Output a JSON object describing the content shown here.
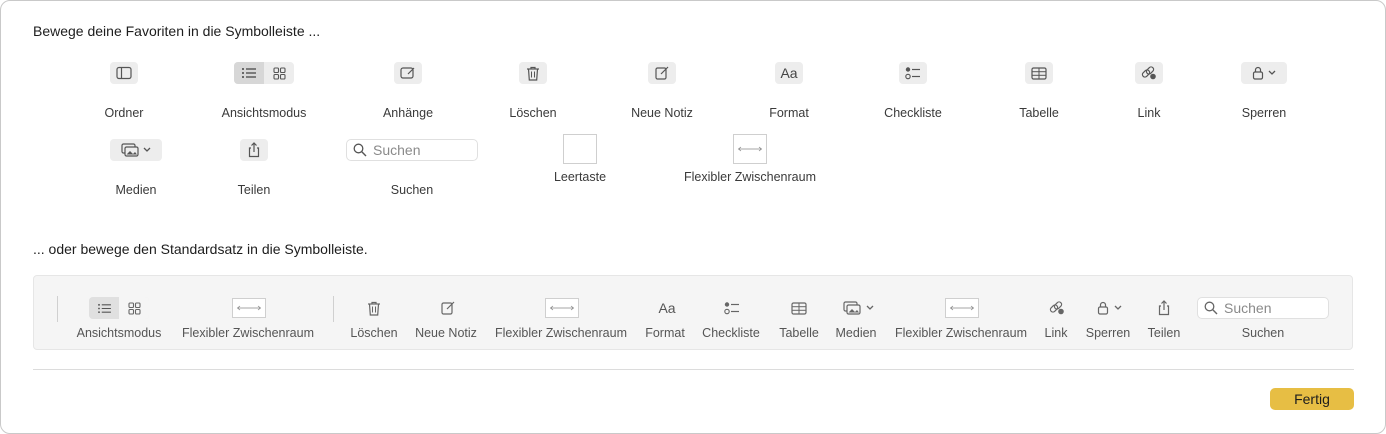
{
  "heading_favorites": "Bewege deine Favoriten in die Symbolleiste ...",
  "heading_default": "... oder bewege den Standardsatz in die Symbolleiste.",
  "palette": {
    "ordner": "Ordner",
    "ansichtsmodus": "Ansichtsmodus",
    "anhaenge": "Anhänge",
    "loeschen": "Löschen",
    "neue_notiz": "Neue Notiz",
    "format": "Format",
    "format_glyph": "Aa",
    "checkliste": "Checkliste",
    "tabelle": "Tabelle",
    "link": "Link",
    "sperren": "Sperren",
    "medien": "Medien",
    "teilen": "Teilen",
    "suchen": "Suchen",
    "suchen_placeholder": "Suchen",
    "leertaste": "Leertaste",
    "flex": "Flexibler Zwischenraum"
  },
  "default_set": {
    "ansichtsmodus": "Ansichtsmodus",
    "flex1": "Flexibler Zwischenraum",
    "loeschen": "Löschen",
    "neue_notiz": "Neue Notiz",
    "flex2": "Flexibler Zwischenraum",
    "format": "Format",
    "format_glyph": "Aa",
    "checkliste": "Checkliste",
    "tabelle": "Tabelle",
    "medien": "Medien",
    "flex3": "Flexibler Zwischenraum",
    "link": "Link",
    "sperren": "Sperren",
    "teilen": "Teilen",
    "suchen": "Suchen",
    "suchen_placeholder": "Suchen"
  },
  "done_label": "Fertig",
  "colors": {
    "accent": "#e7be44",
    "icon_bg": "#ededed",
    "strip_bg": "#f5f5f5"
  }
}
